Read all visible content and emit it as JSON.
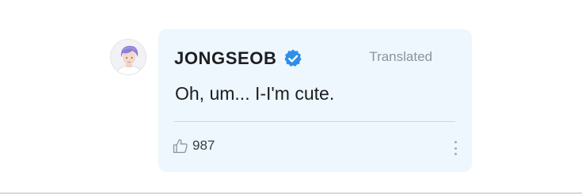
{
  "comment": {
    "author": "JONGSEOB",
    "translated_label": "Translated",
    "message": "Oh, um... I-I'm cute.",
    "likes": "987"
  },
  "icons": {
    "avatar": "avatar-photo",
    "verified": "verified-badge-icon",
    "like": "thumbs-up-icon",
    "more": "more-vertical-icon"
  },
  "colors": {
    "card_background": "#edf7fd",
    "verified_badge": "#2f8ee6",
    "author_text": "#1d1d22",
    "muted_text": "#8e939a"
  }
}
